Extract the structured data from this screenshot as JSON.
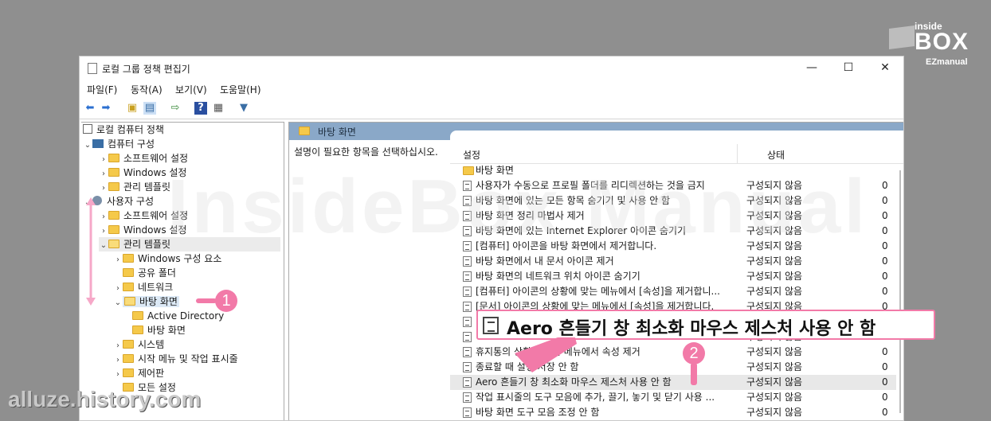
{
  "window": {
    "title": "로컬 그룹 정책 편집기",
    "minimize": "—",
    "maximize": "☐",
    "close": "✕"
  },
  "menu": [
    "파일(F)",
    "동작(A)",
    "보기(V)",
    "도움말(H)"
  ],
  "toolbar_icons": [
    "back-icon",
    "forward-icon",
    "up-folder-icon",
    "show-hide-tree-icon",
    "export-icon",
    "help-icon",
    "properties-icon",
    "filter-icon"
  ],
  "tree": {
    "root": "로컬 컴퓨터 정책",
    "computer_config": "컴퓨터 구성",
    "cc_software": "소프트웨어 설정",
    "cc_windows": "Windows 설정",
    "cc_admin": "관리 템플릿",
    "user_config": "사용자 구성",
    "uc_software": "소프트웨어 설정",
    "uc_windows": "Windows 설정",
    "uc_admin": "관리 템플릿",
    "win_components": "Windows 구성 요소",
    "shared_folders": "공유 폴더",
    "network": "네트워크",
    "desktop": "바탕 화면",
    "active_directory": "Active Directory",
    "desktop_sub": "바탕 화면",
    "system": "시스템",
    "start_menu": "시작 메뉴 및 작업 표시줄",
    "control_panel": "제어판",
    "all_settings": "모든 설정"
  },
  "right": {
    "band_title": "바탕 화면",
    "description": "설명이 필요한 항목을 선택하십시오.",
    "col_setting": "설정",
    "col_state": "상태",
    "folder_row": "바탕 화면",
    "rows": [
      {
        "name": "사용자가 수동으로 프로필 폴더를 리디렉션하는 것을 금지",
        "state": "구성되지 않음",
        "c": "0"
      },
      {
        "name": "바탕 화면에 있는 모든 항목 숨기기 및 사용 안 함",
        "state": "구성되지 않음",
        "c": "0"
      },
      {
        "name": "바탕 화면 정리 마법사 제거",
        "state": "구성되지 않음",
        "c": "0"
      },
      {
        "name": "바탕 화면에 있는 Internet Explorer 아이콘 숨기기",
        "state": "구성되지 않음",
        "c": "0"
      },
      {
        "name": "[컴퓨터] 아이콘을 바탕 화면에서 제거합니다.",
        "state": "구성되지 않음",
        "c": "0"
      },
      {
        "name": "바탕 화면에서 내 문서 아이콘 제거",
        "state": "구성되지 않음",
        "c": "0"
      },
      {
        "name": "바탕 화면의 네트워크 위치 아이콘 숨기기",
        "state": "구성되지 않음",
        "c": "0"
      },
      {
        "name": "[컴퓨터] 아이콘의 상황에 맞는 메뉴에서 [속성]을 제거합니...",
        "state": "구성되지 않음",
        "c": "0"
      },
      {
        "name": "[문서] 아이콘의 상황에 맞는 메뉴에서 [속성]을 제거합니다.",
        "state": "구성되지 않음",
        "c": "0"
      },
      {
        "name": "",
        "state": "구성되지 않음",
        "c": "0"
      },
      {
        "name": "",
        "state": "구성되지 않음",
        "c": "0"
      },
      {
        "name": "휴지통의 상황에 맞는 메뉴에서 속성 제거",
        "state": "구성되지 않음",
        "c": "0"
      },
      {
        "name": "종료할 때 설정 저장 안 함",
        "state": "구성되지 않음",
        "c": "0"
      },
      {
        "name": "Aero 흔들기 창 최소화 마우스 제스처 사용 안 함",
        "state": "구성되지 않음",
        "c": "0"
      },
      {
        "name": "작업 표시줄의 도구 모음에 추가, 끌기, 놓기 및 닫기 사용 ...",
        "state": "구성되지 않음",
        "c": "0"
      },
      {
        "name": "바탕 화면 도구 모음 조정 안 함",
        "state": "구성되지 않음",
        "c": "0"
      }
    ]
  },
  "callout": {
    "text": "Aero 흔들기 창 최소화 마우스 제스처 사용 안 함"
  },
  "badges": {
    "one": "1",
    "two": "2"
  },
  "watermark": "alluze.history.com",
  "logo": {
    "line1": "inside",
    "line2": "BOX",
    "line3": "EZmanual"
  },
  "colors": {
    "accent": "#f27aa8",
    "band": "#8aa8c8",
    "selection": "#dce9f6"
  }
}
